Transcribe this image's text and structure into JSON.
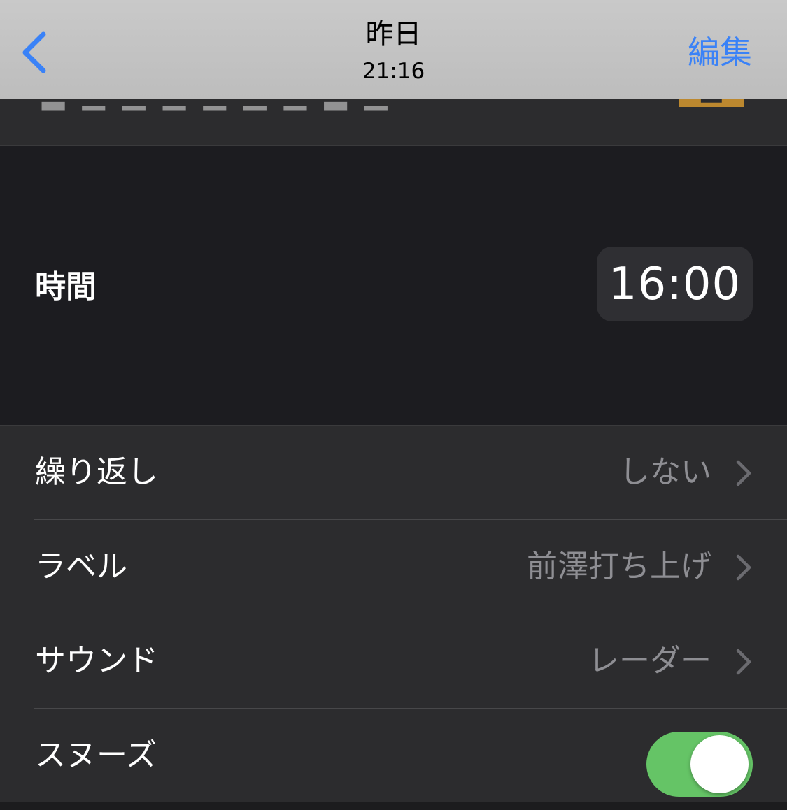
{
  "nav": {
    "title": "昨日",
    "subtitle": "21:16",
    "edit_label": "編集",
    "back_icon": "chevron-left-icon"
  },
  "time_section": {
    "label": "時間",
    "value": "16:00"
  },
  "rows": [
    {
      "label": "繰り返し",
      "value": "しない",
      "icon": "chevron-right-icon"
    },
    {
      "label": "ラベル",
      "value": "前澤打ち上げ",
      "icon": "chevron-right-icon"
    },
    {
      "label": "サウンド",
      "value": "レーダー",
      "icon": "chevron-right-icon"
    }
  ],
  "snooze": {
    "label": "スヌーズ",
    "enabled": true
  },
  "colors": {
    "accent": "#3a82f7",
    "toggle_on": "#65c466",
    "background": "#1c1c1e",
    "row_background": "#2c2c2e",
    "secondary_text": "#8e8e93"
  }
}
